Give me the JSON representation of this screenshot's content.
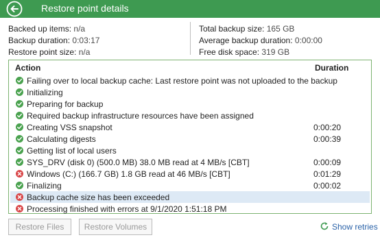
{
  "window": {
    "title": "Restore point details"
  },
  "stats": {
    "backed_up_items_label": "Backed up items:",
    "backed_up_items_value": "n/a",
    "backup_duration_label": "Backup duration:",
    "backup_duration_value": "0:03:17",
    "restore_point_size_label": "Restore point size:",
    "restore_point_size_value": "n/a",
    "total_backup_size_label": "Total backup size:",
    "total_backup_size_value": "165 GB",
    "average_backup_duration_label": "Average backup duration:",
    "average_backup_duration_value": "0:00:00",
    "free_disk_space_label": "Free disk space:",
    "free_disk_space_value": "319 GB"
  },
  "table": {
    "headers": {
      "action": "Action",
      "duration": "Duration"
    },
    "rows": [
      {
        "status": "success",
        "action": "Failing over to local backup cache: Last restore point was not uploaded to the backup",
        "duration": ""
      },
      {
        "status": "success",
        "action": "Initializing",
        "duration": ""
      },
      {
        "status": "success",
        "action": "Preparing for backup",
        "duration": ""
      },
      {
        "status": "success",
        "action": "Required backup infrastructure resources have been assigned",
        "duration": ""
      },
      {
        "status": "success",
        "action": "Creating VSS snapshot",
        "duration": "0:00:20"
      },
      {
        "status": "success",
        "action": "Calculating digests",
        "duration": "0:00:39"
      },
      {
        "status": "success",
        "action": "Getting list of local users",
        "duration": ""
      },
      {
        "status": "success",
        "action": "SYS_DRV (disk 0) (500.0 MB) 38.0 MB read at 4 MB/s [CBT]",
        "duration": "0:00:09"
      },
      {
        "status": "error",
        "action": "Windows (C:) (166.7 GB) 1.8 GB read at 46 MB/s [CBT]",
        "duration": "0:01:29"
      },
      {
        "status": "success",
        "action": "Finalizing",
        "duration": "0:00:02"
      },
      {
        "status": "error",
        "action": "Backup cache size has been exceeded",
        "duration": "",
        "highlighted": true
      },
      {
        "status": "error",
        "action": "Processing finished with errors at 9/1/2020 1:51:18 PM",
        "duration": ""
      }
    ]
  },
  "buttons": {
    "restore_files": "Restore Files",
    "restore_volumes": "Restore Volumes",
    "show_retries": "Show retries"
  },
  "colors": {
    "title_bar": "#3e9a51",
    "success_icon": "#4aa24f",
    "error_icon": "#d9484a",
    "highlight_row": "#dde9f5",
    "link": "#2a62a8"
  },
  "icons": {
    "back": "back-arrow-icon",
    "success": "check-circle-icon",
    "error": "error-circle-icon",
    "retries": "refresh-icon"
  }
}
